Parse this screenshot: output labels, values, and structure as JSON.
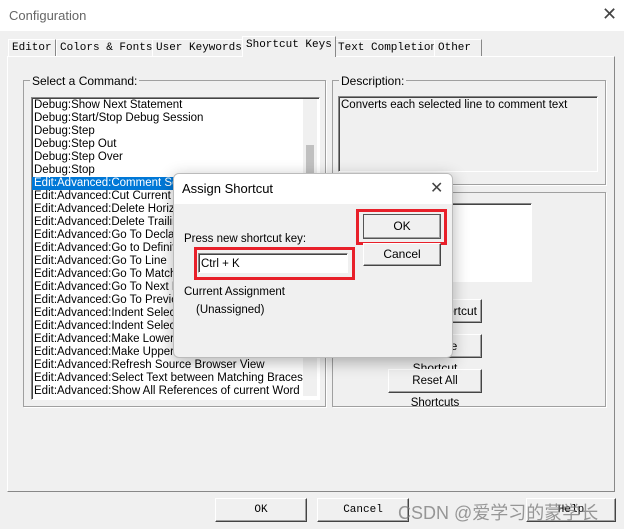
{
  "window": {
    "title": "Configuration"
  },
  "tabs": [
    {
      "label": "Editor"
    },
    {
      "label": "Colors & Fonts"
    },
    {
      "label": "User Keywords"
    },
    {
      "label": "Shortcut Keys",
      "active": true
    },
    {
      "label": "Text Completion"
    },
    {
      "label": "Other"
    }
  ],
  "commands": {
    "label": "Select a Command:",
    "items": [
      "Debug:Show Next Statement",
      "Debug:Start/Stop Debug Session",
      "Debug:Step",
      "Debug:Step Out",
      "Debug:Step Over",
      "Debug:Stop",
      "Edit:Advanced:Comment Selection",
      "Edit:Advanced:Cut Current Line",
      "Edit:Advanced:Delete Horizontal Whitespace",
      "Edit:Advanced:Delete Trailing Whitespace",
      "Edit:Advanced:Go To Declaration",
      "Edit:Advanced:Go to Definition",
      "Edit:Advanced:Go To Line",
      "Edit:Advanced:Go To Matching Brace",
      "Edit:Advanced:Go To Next Reference",
      "Edit:Advanced:Go To Previous Reference",
      "Edit:Advanced:Indent Selection",
      "Edit:Advanced:Indent Selection",
      "Edit:Advanced:Make Lowercase",
      "Edit:Advanced:Make Uppercase",
      "Edit:Advanced:Refresh Source Browser View",
      "Edit:Advanced:Select Text between Matching Braces",
      "Edit:Advanced:Show All References of current Word"
    ],
    "selected_index": 6
  },
  "description": {
    "label": "Description:",
    "text": "Converts each selected line to comment text"
  },
  "shortcut_buttons": {
    "assign": "Assign Shortcut",
    "remove": "Remove Shortcut",
    "reset": "Reset All Shortcuts"
  },
  "footer": {
    "ok": "OK",
    "cancel": "Cancel",
    "help": "Help"
  },
  "watermark": "CSDN @爱学习的蒙学长",
  "dialog": {
    "title": "Assign Shortcut",
    "ok": "OK",
    "cancel": "Cancel",
    "prompt": "Press new shortcut key:",
    "value": "Ctrl + K",
    "current_label": "Current Assignment",
    "current_value": "(Unassigned)"
  },
  "colors": {
    "selection": "#0078d7",
    "highlight": "#e8202a"
  }
}
